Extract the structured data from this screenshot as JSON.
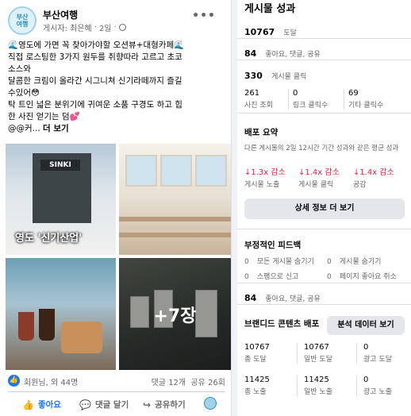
{
  "post": {
    "page_name": "부산여행",
    "avatar_text": [
      "부산",
      "여행"
    ],
    "author": "게시자: 최은혜",
    "time": "2일",
    "lines": [
      "🌊영도에 가면 꼭 찾아가야할 오션뷰+대형카페🌊",
      "직접 로스팅한 3가지 원두를 취향따라 고르고 초코",
      "소스와",
      "달콤한 크림이 올라간 시그니쳐 신기라떼까지 즐길",
      "수있어😳",
      "탁 트인 넓은 분위기에 귀여운 소품 구경도 하고 힙",
      "한 사진 얻기는 덤💕"
    ],
    "last_line": "@@커...",
    "more_label": "더 보기",
    "image_caption": "영도 '신기산업'",
    "sign_text": "SINKI",
    "more_photos": "+7장",
    "reactions_names": "회원님, 외 44명",
    "comments": "댓글 12개",
    "shares": "공유 26회",
    "like_label": "좋아요",
    "comment_label": "댓글 달기",
    "share_label": "공유하기"
  },
  "insights": {
    "title": "게시물 성과",
    "reach_num": "10767",
    "reach_lbl": "도달",
    "engage_num": "84",
    "engage_lbl": "좋아요, 댓글, 공유",
    "clicks_num": "330",
    "clicks_lbl": "게시물 클릭",
    "click_breakdown": [
      {
        "num": "261",
        "lbl": "사진 조회"
      },
      {
        "num": "0",
        "lbl": "링크 클릭수"
      },
      {
        "num": "69",
        "lbl": "기타 클릭수"
      }
    ],
    "dist_title": "배포 요약",
    "dist_desc": "다른 게시물의 2일 12시간 기간 성과와 같은 평균 성과",
    "dist_items": [
      {
        "num": "1.3x 감소",
        "lbl": "게시물 노출"
      },
      {
        "num": "1.4x 감소",
        "lbl": "게시물 클릭"
      },
      {
        "num": "1.4x 감소",
        "lbl": "공감"
      }
    ],
    "details_btn": "상세 정보 더 보기",
    "neg_title": "부정적인 피드백",
    "neg_items": [
      {
        "num": "0",
        "lbl": "모든 게시물 숨기기"
      },
      {
        "num": "0",
        "lbl": "게시물 숨기기"
      },
      {
        "num": "0",
        "lbl": "스팸으로 신고"
      },
      {
        "num": "0",
        "lbl": "페이지 좋아요 취소"
      }
    ],
    "engage2_num": "84",
    "engage2_lbl": "좋아요, 댓글, 공유",
    "branded_title": "브랜디드 콘텐츠 배포",
    "analysis_btn": "분석 데이터 보기",
    "branded_rows": [
      [
        {
          "num": "10767",
          "lbl": "총 도달"
        },
        {
          "num": "10767",
          "lbl": "일반 도달"
        },
        {
          "num": "0",
          "lbl": "광고 도달"
        }
      ],
      [
        {
          "num": "11425",
          "lbl": "총 노출"
        },
        {
          "num": "11425",
          "lbl": "일반 노출"
        },
        {
          "num": "0",
          "lbl": "광고 노출"
        }
      ]
    ]
  }
}
